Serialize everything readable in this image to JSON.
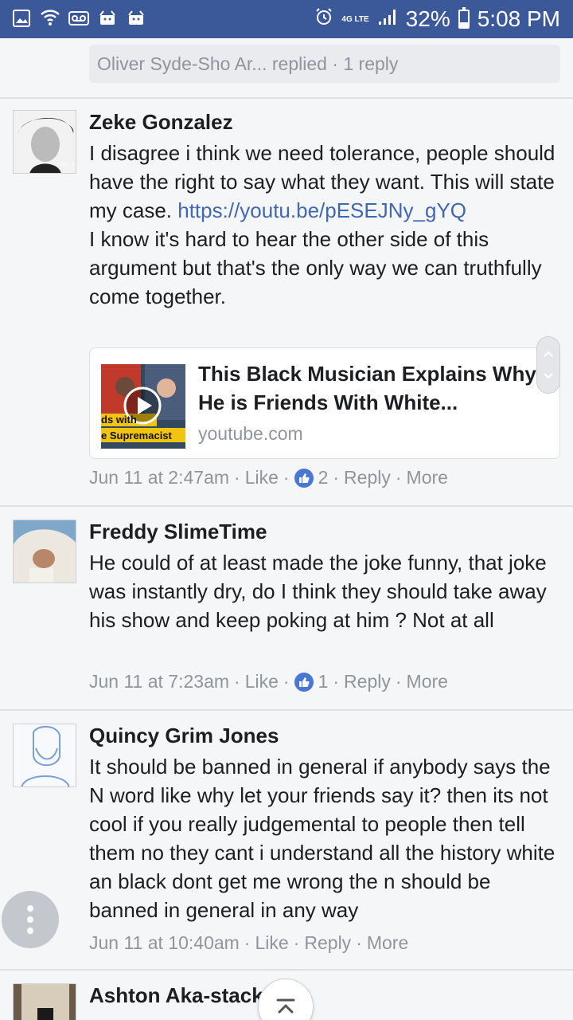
{
  "status_bar": {
    "battery_percent": "32%",
    "time": "5:08 PM",
    "battery_level": 0.32,
    "network": "4G LTE"
  },
  "thread_summary": "Oliver Syde-Sho Ar... replied · 1 reply",
  "comments": [
    {
      "name": "Zeke Gonzalez",
      "text_before_link": "I disagree i think we need tolerance, people should have the right to say what they want. This will state my case. ",
      "link": "https://youtu.be/pESEJNy_gYQ",
      "text_after_link": "I know it's hard to hear the other side of this argument but that's the only way we can truthfully come together.",
      "card": {
        "title": "This Black Musician Explains Why He is Friends With White...",
        "domain": "youtube.com",
        "thumb_text_1": "ds with",
        "thumb_text_2": "e Supremacist"
      },
      "timestamp": "Jun 11 at 2:47am",
      "like_label": "Like",
      "like_count": "2",
      "reply_label": "Reply",
      "more_label": "More"
    },
    {
      "name": "Freddy SlimeTime",
      "text": "He could of at least made the joke funny, that joke was instantly dry, do I think they should take away his show and keep poking at him ? Not at all",
      "timestamp": "Jun 11 at 7:23am",
      "like_label": "Like",
      "like_count": "1",
      "reply_label": "Reply",
      "more_label": "More"
    },
    {
      "name": "Quincy Grim Jones",
      "text": "It should be banned in general if anybody says the N word like why let your friends say it? then its not cool if you really judgemental to people then tell them no they cant i understand all the history white an black dont get me wrong the n should be banned in general in any way",
      "timestamp": "Jun 11 at 10:40am",
      "like_label": "Like",
      "reply_label": "Reply",
      "more_label": "More"
    },
    {
      "name": "Ashton Aka-stackz"
    }
  ],
  "colors": {
    "status_bar": "#3b5998",
    "link": "#4267b2",
    "like_badge": "#4a76d6",
    "meta": "#90949c"
  }
}
